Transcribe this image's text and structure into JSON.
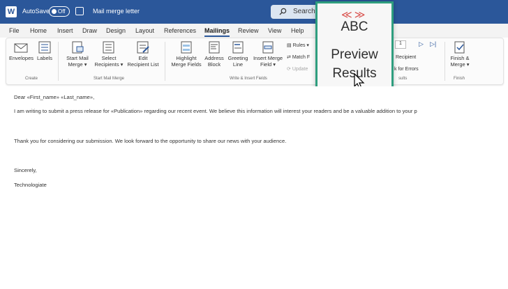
{
  "titlebar": {
    "autosave_label": "AutoSave",
    "autosave_state": "Off",
    "doc_title": "Mail merge letter",
    "search_label": "Search"
  },
  "menu": {
    "tabs": [
      "File",
      "Home",
      "Insert",
      "Draw",
      "Design",
      "Layout",
      "References",
      "Mailings",
      "Review",
      "View",
      "Help"
    ],
    "active": "Mailings"
  },
  "ribbon": {
    "create": {
      "envelopes": "Envelopes",
      "labels": "Labels",
      "group": "Create"
    },
    "start": {
      "start_mail_merge": [
        "Start Mail",
        "Merge"
      ],
      "select_recipients": [
        "Select",
        "Recipients"
      ],
      "edit_list": [
        "Edit",
        "Recipient List"
      ],
      "group": "Start Mail Merge"
    },
    "write": {
      "highlight": [
        "Highlight",
        "Merge Fields"
      ],
      "address": [
        "Address",
        "Block"
      ],
      "greeting": [
        "Greeting",
        "Line"
      ],
      "insert_field": [
        "Insert Merge",
        "Field"
      ],
      "rules": "Rules",
      "match": "Match F",
      "update": "Update",
      "group": "Write & Insert Fields"
    },
    "preview": {
      "recipient": "Recipient",
      "check_errors": "k for Errors",
      "group": "sults",
      "record": "1"
    },
    "finish": {
      "finish_merge": [
        "Finish &",
        "Merge"
      ],
      "group": "Finish"
    }
  },
  "zoom": {
    "abc": "ABC",
    "preview_line1": "Preview",
    "preview_line2": "Results"
  },
  "document": {
    "greeting": "Dear «First_name» «Last_name»,",
    "para1": "I am writing to submit a press release for «Publication» regarding our recent event. We believe this information will interest your readers and be a valuable addition to your p",
    "para2": "Thank you for considering our submission. We look forward to the opportunity to share our news with your audience.",
    "closing": "Sincerely,",
    "signature": "Technologiate"
  },
  "colors": {
    "title_blue": "#2b579a",
    "callout_green": "#2f9e7f",
    "arrows_red": "#d9534f"
  }
}
